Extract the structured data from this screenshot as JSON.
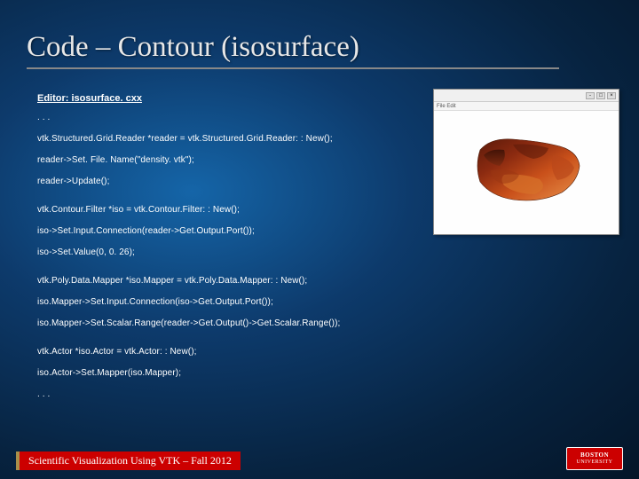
{
  "title": "Code – Contour (isosurface)",
  "editor_label": "Editor: isosurface. cxx",
  "code": {
    "l0": ". . .",
    "l1": "vtk.Structured.Grid.Reader *reader = vtk.Structured.Grid.Reader: : New();",
    "l2": "reader->Set. File. Name(\"density. vtk\");",
    "l3": "reader->Update();",
    "l4": "vtk.Contour.Filter *iso = vtk.Contour.Filter: : New();",
    "l5": "iso->Set.Input.Connection(reader->Get.Output.Port());",
    "l6": "iso->Set.Value(0, 0. 26);",
    "l7": "vtk.Poly.Data.Mapper *iso.Mapper = vtk.Poly.Data.Mapper: : New();",
    "l8": "iso.Mapper->Set.Input.Connection(iso->Get.Output.Port());",
    "l9": "iso.Mapper->Set.Scalar.Range(reader->Get.Output()->Get.Scalar.Range());",
    "l10": "vtk.Actor *iso.Actor = vtk.Actor: : New();",
    "l11": "iso.Actor->Set.Mapper(iso.Mapper);",
    "l12": ". . ."
  },
  "thumb_menu": "File  Edit",
  "footer_label": "Scientific Visualization Using VTK – Fall 2012",
  "logo": {
    "line1": "BOSTON",
    "line2": "UNIVERSITY"
  }
}
